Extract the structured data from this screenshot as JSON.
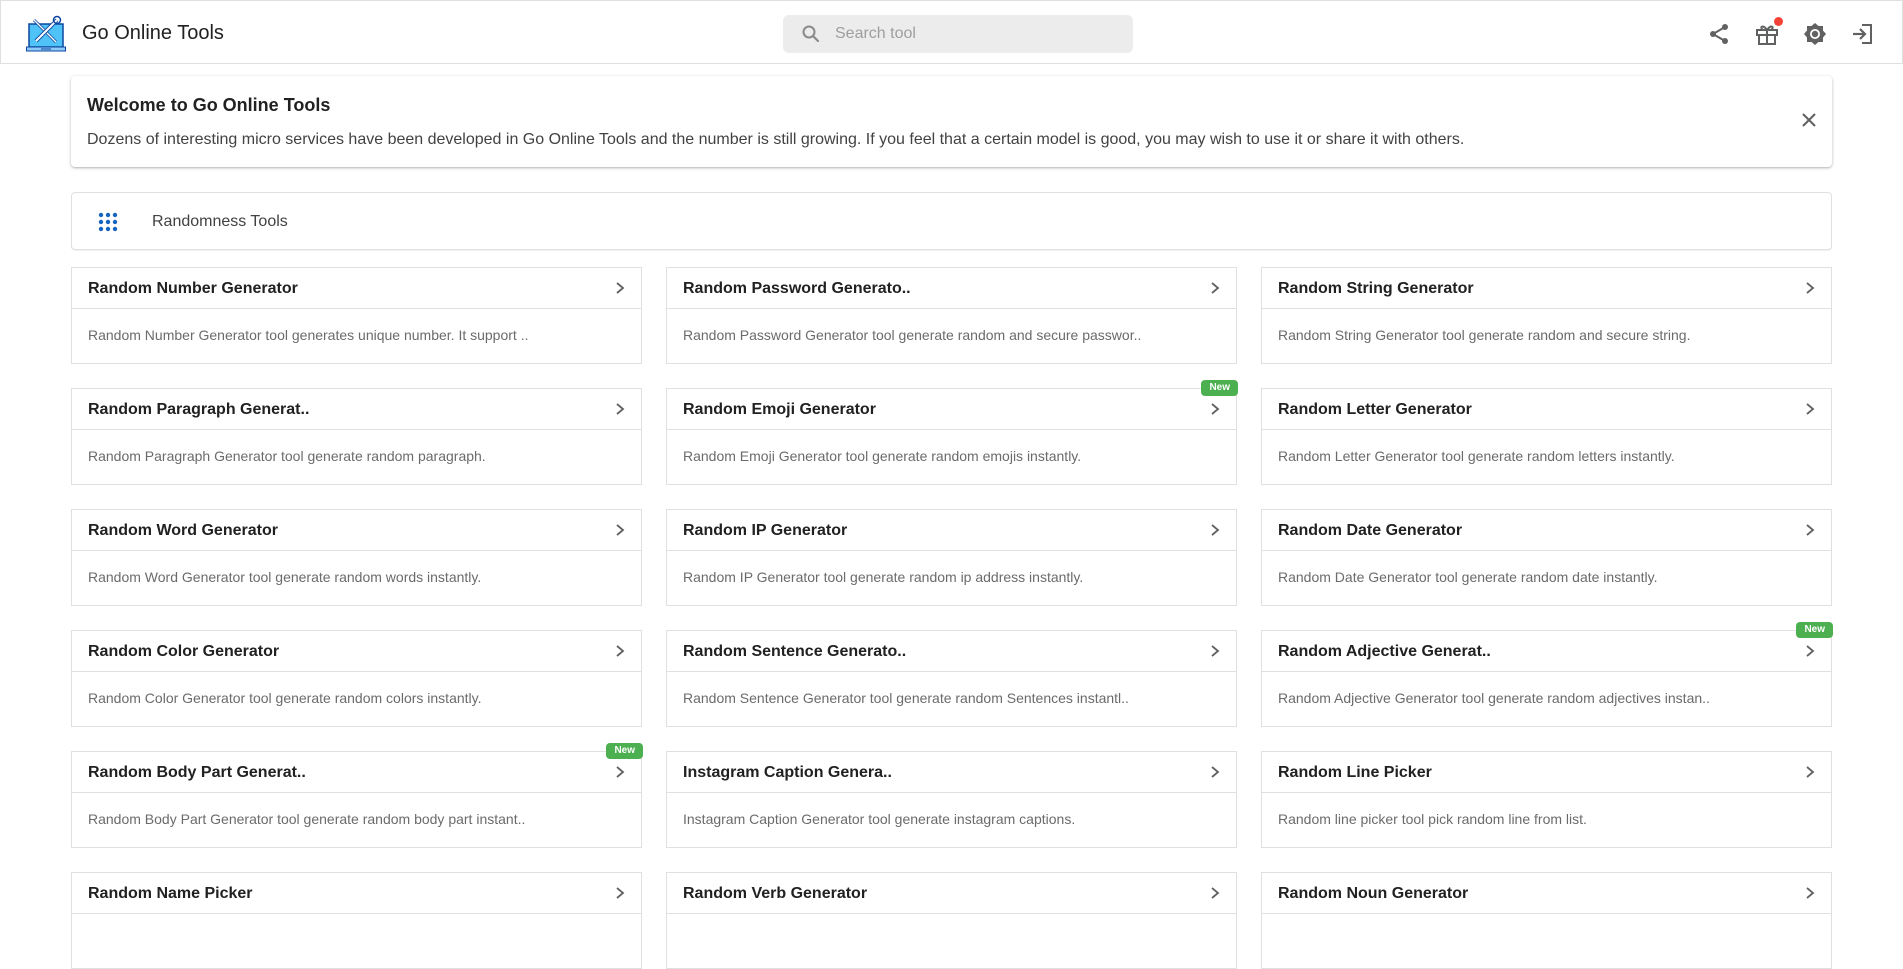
{
  "header": {
    "app_title": "Go Online Tools",
    "logo_icon": "laptop-tools-logo",
    "search_placeholder": "Search tool",
    "search_value": "",
    "actions": [
      {
        "name": "share-icon"
      },
      {
        "name": "gift-icon",
        "notification": true
      },
      {
        "name": "theme-brightness-icon"
      },
      {
        "name": "login-icon"
      }
    ]
  },
  "welcome": {
    "title": "Welcome to Go Online Tools",
    "text": "Dozens of interesting micro services have been developed in Go Online Tools and the number is still growing. If you feel that a certain model is good, you may wish to use it or share it with others."
  },
  "category": {
    "icon": "apps-grid-icon",
    "label": "Randomness Tools"
  },
  "colors": {
    "accent": "#1565c0",
    "new_badge": "#4caf50",
    "notification_dot": "#f44336"
  },
  "tools": [
    {
      "title": "Random Number Generator",
      "description": "Random Number Generator tool generates unique number. It support ..",
      "badge": ""
    },
    {
      "title": "Random Password Generato..",
      "description": "Random Password Generator tool generate random and secure passwor..",
      "badge": ""
    },
    {
      "title": "Random String Generator",
      "description": "Random String Generator tool generate random and secure string.",
      "badge": ""
    },
    {
      "title": "Random Paragraph Generat..",
      "description": "Random Paragraph Generator tool generate random paragraph.",
      "badge": ""
    },
    {
      "title": "Random Emoji Generator",
      "description": "Random Emoji Generator tool generate random emojis instantly.",
      "badge": "New"
    },
    {
      "title": "Random Letter Generator",
      "description": "Random Letter Generator tool generate random letters instantly.",
      "badge": ""
    },
    {
      "title": "Random Word Generator",
      "description": "Random Word Generator tool generate random words instantly.",
      "badge": ""
    },
    {
      "title": "Random IP Generator",
      "description": "Random IP Generator tool generate random ip address instantly.",
      "badge": ""
    },
    {
      "title": "Random Date Generator",
      "description": "Random Date Generator tool generate random date instantly.",
      "badge": ""
    },
    {
      "title": "Random Color Generator",
      "description": "Random Color Generator tool generate random colors instantly.",
      "badge": ""
    },
    {
      "title": "Random Sentence Generato..",
      "description": "Random Sentence Generator tool generate random Sentences instantl..",
      "badge": ""
    },
    {
      "title": "Random Adjective Generat..",
      "description": "Random Adjective Generator tool generate random adjectives instan..",
      "badge": "New"
    },
    {
      "title": "Random Body Part Generat..",
      "description": "Random Body Part Generator tool generate random body part instant..",
      "badge": "New"
    },
    {
      "title": "Instagram Caption Genera..",
      "description": "Instagram Caption Generator tool generate instagram captions.",
      "badge": ""
    },
    {
      "title": "Random Line Picker",
      "description": "Random line picker tool pick random line from list.",
      "badge": ""
    },
    {
      "title": "Random Name Picker",
      "description": "",
      "badge": ""
    },
    {
      "title": "Random Verb Generator",
      "description": "",
      "badge": ""
    },
    {
      "title": "Random Noun Generator",
      "description": "",
      "badge": ""
    }
  ]
}
